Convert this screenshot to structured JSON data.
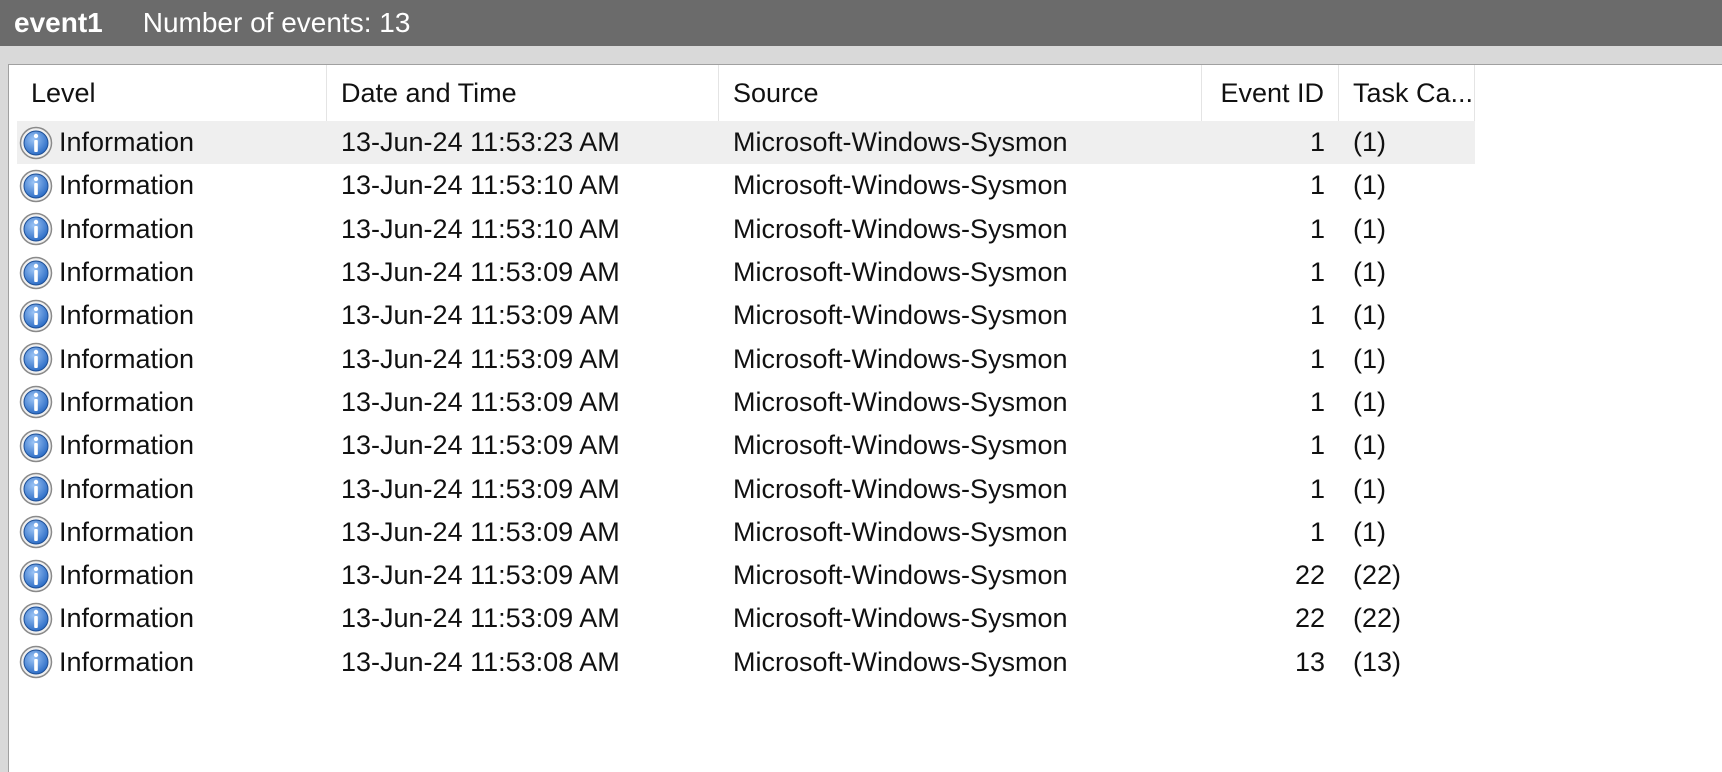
{
  "titlebar": {
    "log_name": "event1",
    "event_count_label": "Number of events: 13"
  },
  "columns": {
    "level": "Level",
    "date_time": "Date and Time",
    "source": "Source",
    "event_id": "Event ID",
    "task_category": "Task Ca..."
  },
  "icons": {
    "level_icon": "info-icon"
  },
  "colors": {
    "titlebar_bg": "#6b6b6b",
    "selected_row_bg": "#efefef",
    "icon_blue": "#2f6fc7"
  },
  "rows": [
    {
      "level": "Information",
      "date_time": "13-Jun-24 11:53:23 AM",
      "source": "Microsoft-Windows-Sysmon",
      "event_id": "1",
      "task_category": "(1)",
      "selected": true
    },
    {
      "level": "Information",
      "date_time": "13-Jun-24 11:53:10 AM",
      "source": "Microsoft-Windows-Sysmon",
      "event_id": "1",
      "task_category": "(1)"
    },
    {
      "level": "Information",
      "date_time": "13-Jun-24 11:53:10 AM",
      "source": "Microsoft-Windows-Sysmon",
      "event_id": "1",
      "task_category": "(1)"
    },
    {
      "level": "Information",
      "date_time": "13-Jun-24 11:53:09 AM",
      "source": "Microsoft-Windows-Sysmon",
      "event_id": "1",
      "task_category": "(1)"
    },
    {
      "level": "Information",
      "date_time": "13-Jun-24 11:53:09 AM",
      "source": "Microsoft-Windows-Sysmon",
      "event_id": "1",
      "task_category": "(1)"
    },
    {
      "level": "Information",
      "date_time": "13-Jun-24 11:53:09 AM",
      "source": "Microsoft-Windows-Sysmon",
      "event_id": "1",
      "task_category": "(1)"
    },
    {
      "level": "Information",
      "date_time": "13-Jun-24 11:53:09 AM",
      "source": "Microsoft-Windows-Sysmon",
      "event_id": "1",
      "task_category": "(1)"
    },
    {
      "level": "Information",
      "date_time": "13-Jun-24 11:53:09 AM",
      "source": "Microsoft-Windows-Sysmon",
      "event_id": "1",
      "task_category": "(1)"
    },
    {
      "level": "Information",
      "date_time": "13-Jun-24 11:53:09 AM",
      "source": "Microsoft-Windows-Sysmon",
      "event_id": "1",
      "task_category": "(1)"
    },
    {
      "level": "Information",
      "date_time": "13-Jun-24 11:53:09 AM",
      "source": "Microsoft-Windows-Sysmon",
      "event_id": "1",
      "task_category": "(1)"
    },
    {
      "level": "Information",
      "date_time": "13-Jun-24 11:53:09 AM",
      "source": "Microsoft-Windows-Sysmon",
      "event_id": "22",
      "task_category": "(22)"
    },
    {
      "level": "Information",
      "date_time": "13-Jun-24 11:53:09 AM",
      "source": "Microsoft-Windows-Sysmon",
      "event_id": "22",
      "task_category": "(22)"
    },
    {
      "level": "Information",
      "date_time": "13-Jun-24 11:53:08 AM",
      "source": "Microsoft-Windows-Sysmon",
      "event_id": "13",
      "task_category": "(13)"
    }
  ]
}
